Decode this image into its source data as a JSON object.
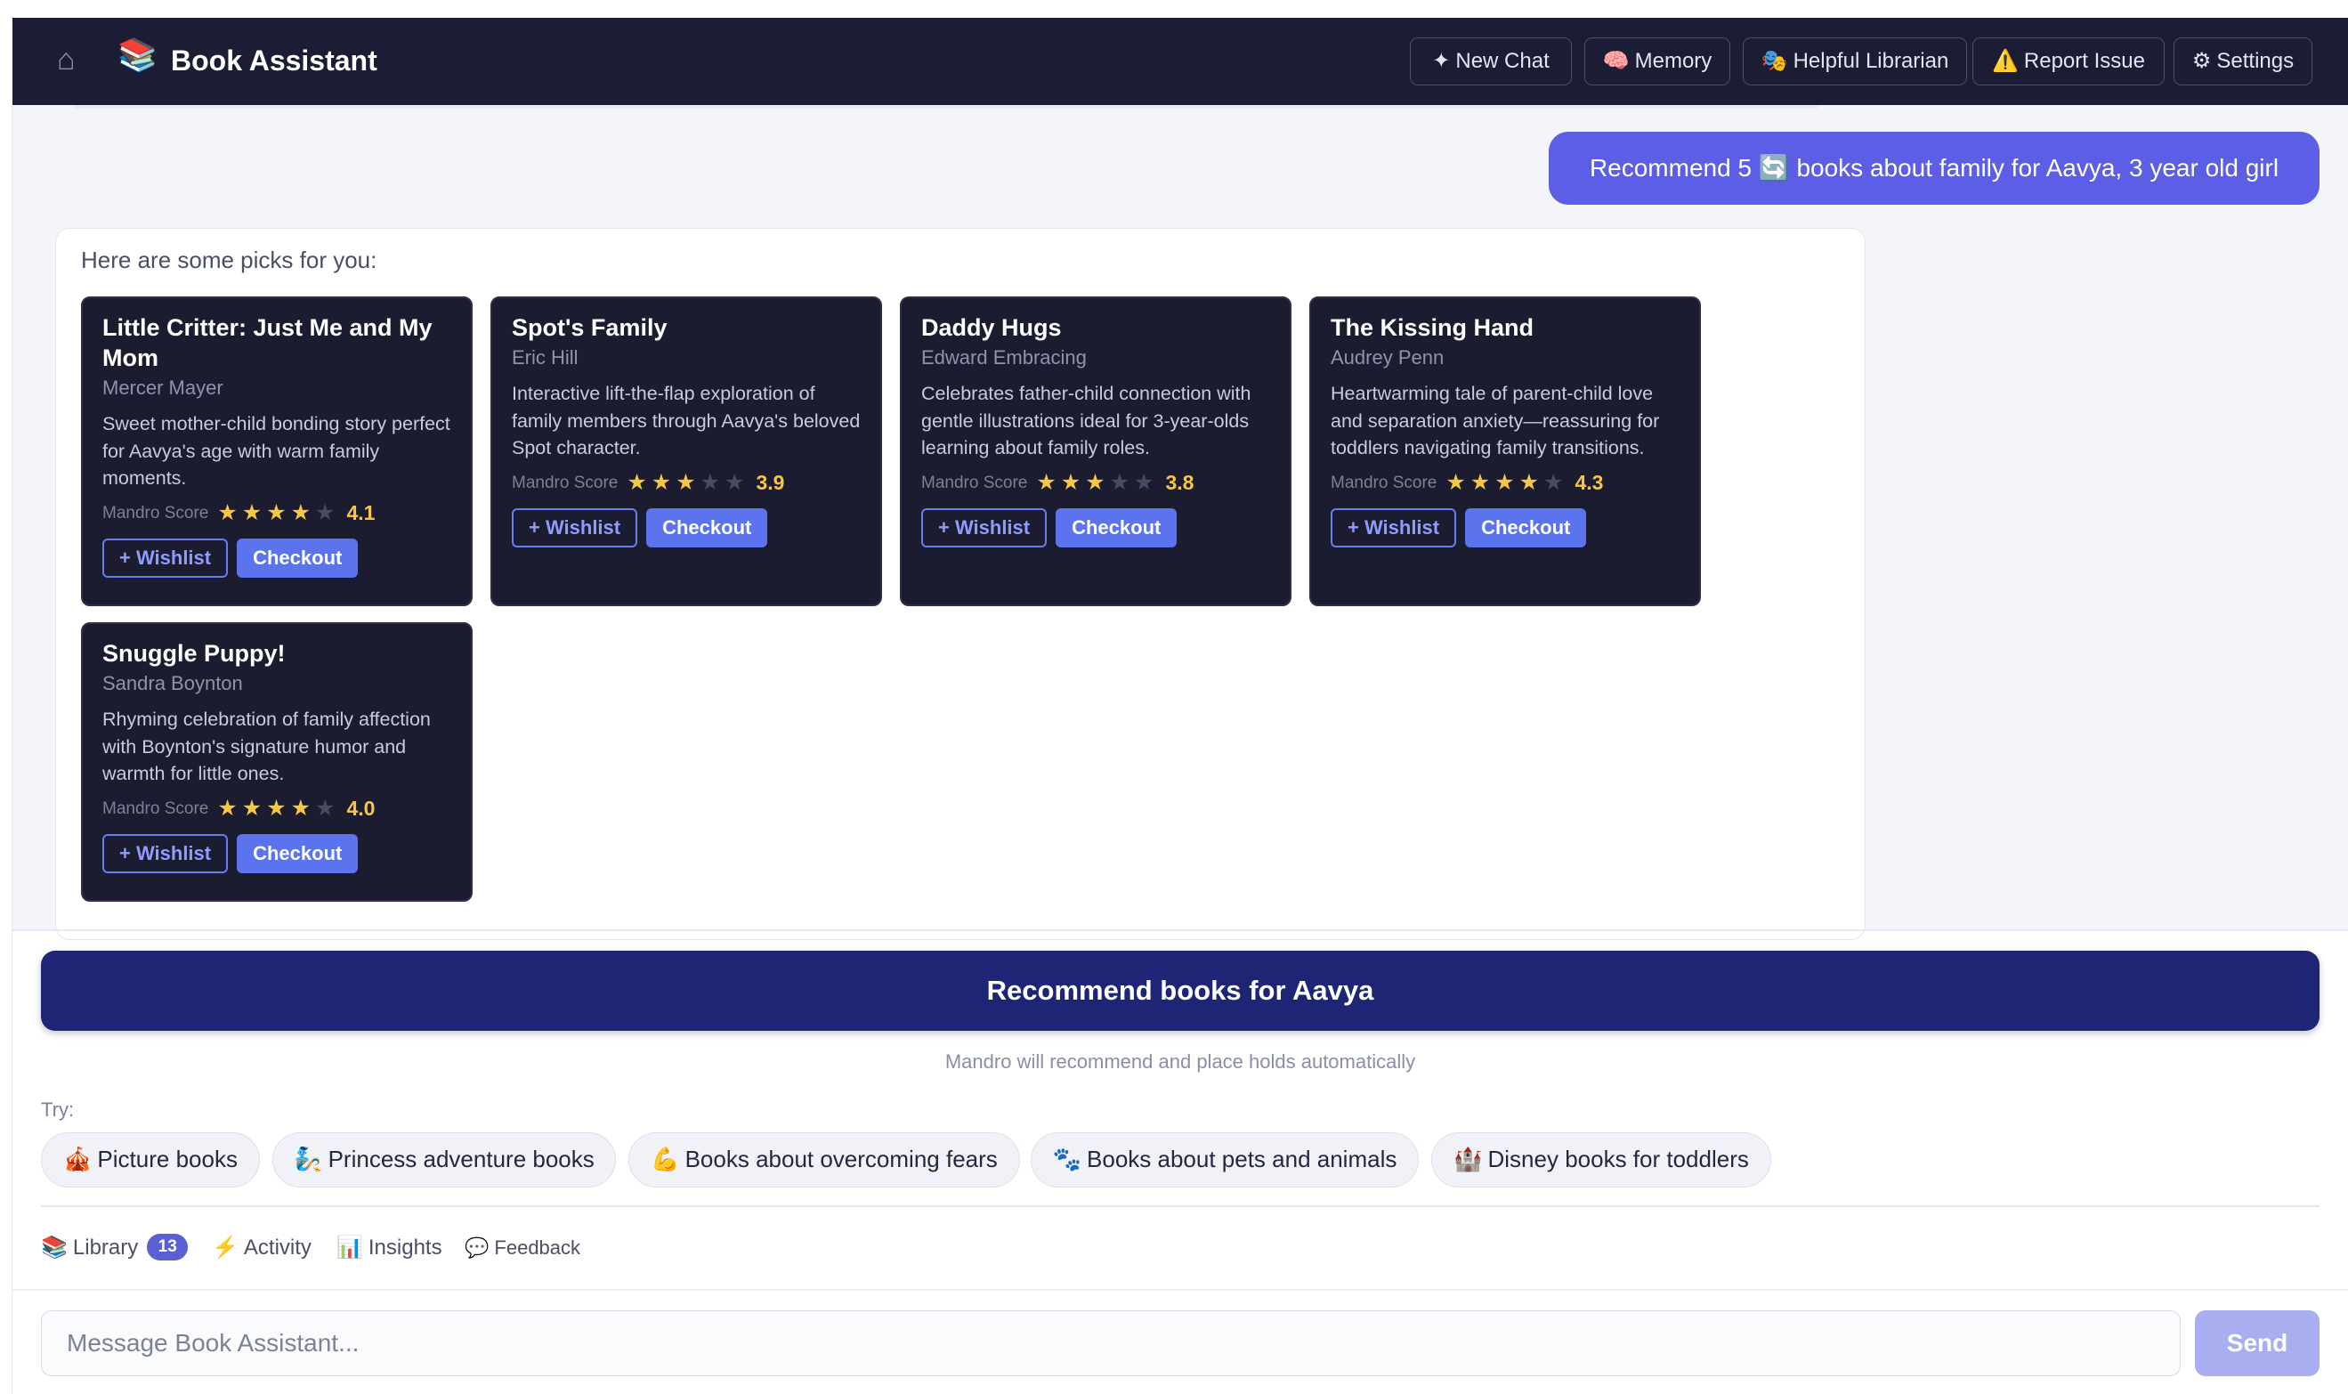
{
  "header": {
    "app_title": "Book Assistant",
    "app_icon": "📚",
    "home_icon": "⌂",
    "buttons": [
      {
        "icon": "✦",
        "label": "New Chat"
      },
      {
        "icon": "🧠",
        "label": "Memory"
      },
      {
        "icon": "🎭",
        "label": "Helpful Librarian"
      },
      {
        "icon": "⚠️",
        "label": "Report Issue"
      },
      {
        "icon": "⚙",
        "label": "Settings"
      }
    ]
  },
  "chat": {
    "user_message": "Recommend 5 🔄 books about family for Aavya, 3 year old girl",
    "assistant_intro": "Here are some picks for you:",
    "score_label": "Mandro Score",
    "wishlist_label": "+ Wishlist",
    "checkout_label": "Checkout",
    "books": [
      {
        "title": "Little Critter: Just Me and My Mom",
        "author": "Mercer Mayer",
        "description": "Sweet mother-child bonding story perfect for Aavya's age with warm family moments.",
        "score": "4.1",
        "stars": 4
      },
      {
        "title": "Spot's Family",
        "author": "Eric Hill",
        "description": "Interactive lift-the-flap exploration of family members through Aavya's beloved Spot character.",
        "score": "3.9",
        "stars": 3
      },
      {
        "title": "Daddy Hugs",
        "author": "Edward Embracing",
        "description": "Celebrates father-child connection with gentle illustrations ideal for 3-year-olds learning about family roles.",
        "score": "3.8",
        "stars": 3
      },
      {
        "title": "The Kissing Hand",
        "author": "Audrey Penn",
        "description": "Heartwarming tale of parent-child love and separation anxiety—reassuring for toddlers navigating family transitions.",
        "score": "4.3",
        "stars": 4
      },
      {
        "title": "Snuggle Puppy!",
        "author": "Sandra Boynton",
        "description": "Rhyming celebration of family affection with Boynton's signature humor and warmth for little ones.",
        "score": "4.0",
        "stars": 4
      }
    ]
  },
  "composer": {
    "main_action": "Recommend books for Aavya",
    "main_action_sub": "Mandro will recommend and place holds automatically",
    "try_label": "Try:",
    "suggestions": [
      {
        "icon": "🎪",
        "label": "Picture books"
      },
      {
        "icon": "🧞",
        "label": "Princess adventure books"
      },
      {
        "icon": "💪",
        "label": "Books about overcoming fears"
      },
      {
        "icon": "🐾",
        "label": "Books about pets and animals"
      },
      {
        "icon": "🏰",
        "label": "Disney books for toddlers"
      }
    ],
    "tabs": [
      {
        "icon": "📚",
        "label": "Library",
        "badge": "13"
      },
      {
        "icon": "⚡",
        "label": "Activity"
      },
      {
        "icon": "📊",
        "label": "Insights"
      },
      {
        "icon": "💬",
        "label": "Feedback"
      }
    ],
    "input_placeholder": "Message Book Assistant...",
    "send_label": "Send"
  }
}
